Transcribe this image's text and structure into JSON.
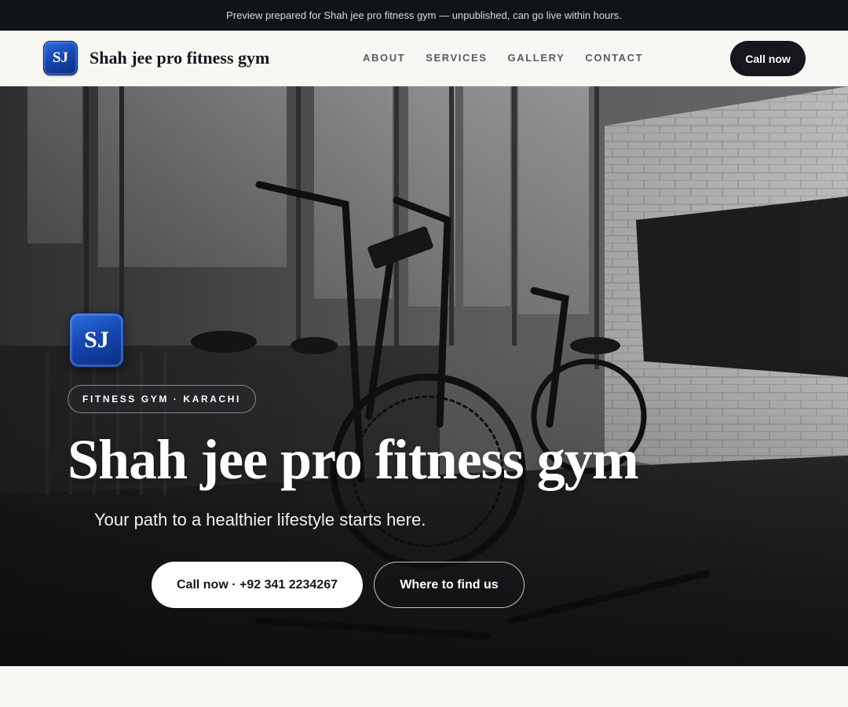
{
  "preview_banner": {
    "text": "Preview prepared for Shah jee pro fitness gym — unpublished, can go live within hours."
  },
  "header": {
    "logo_initials": "SJ",
    "brand_name": "Shah jee pro fitness gym",
    "nav": [
      {
        "label": "ABOUT"
      },
      {
        "label": "SERVICES"
      },
      {
        "label": "GALLERY"
      },
      {
        "label": "CONTACT"
      }
    ],
    "cta_label": "Call now"
  },
  "hero": {
    "background_image": "gym-interior-air-bikes-photo",
    "logo_initials": "SJ",
    "badge": "FITNESS GYM · KARACHI",
    "title": "Shah jee pro fitness gym",
    "subtitle": "Your path to a healthier lifestyle starts here.",
    "primary_button": "Call now · +92 341 2234267",
    "secondary_button": "Where to find us"
  },
  "colors": {
    "banner_bg": "#101318",
    "header_bg": "#f8f7f4",
    "dark_button": "#15171c",
    "logo_blue": "#1547b3",
    "page_bg": "#f8f7f4"
  }
}
